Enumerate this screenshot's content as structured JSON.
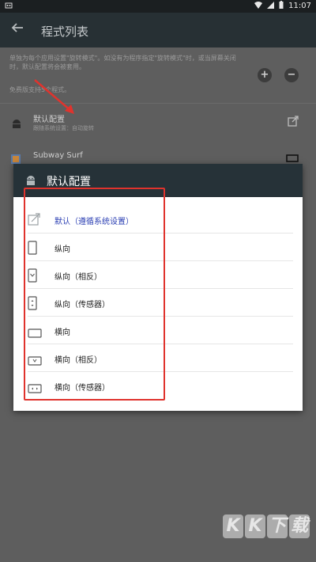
{
  "status_bar": {
    "time": "11:07",
    "left_icon": "notification-icon"
  },
  "app_bar": {
    "title": "程式列表"
  },
  "description": "单独为每个应用设置\"旋转模式\"。如没有为程序指定\"旋转模式\"时，或当屏幕关闭时，默认配置将会被套用。",
  "free_note": "免费版支持5个程式。",
  "apps": [
    {
      "name": "默认配置",
      "sub": "跟随系统设置：自动旋转"
    },
    {
      "name": "Subway Surf",
      "sub": ""
    }
  ],
  "dialog": {
    "title": "默认配置",
    "options": [
      {
        "label": "默认（遵循系统设置）",
        "icon": "follow-system-icon",
        "selected": true
      },
      {
        "label": "纵向",
        "icon": "portrait-icon",
        "selected": false
      },
      {
        "label": "纵向（相反）",
        "icon": "portrait-reverse-icon",
        "selected": false
      },
      {
        "label": "纵向（传感器）",
        "icon": "portrait-sensor-icon",
        "selected": false
      },
      {
        "label": "横向",
        "icon": "landscape-icon",
        "selected": false
      },
      {
        "label": "横向（相反）",
        "icon": "landscape-reverse-icon",
        "selected": false
      },
      {
        "label": "横向（传感器）",
        "icon": "landscape-sensor-icon",
        "selected": false
      }
    ]
  },
  "watermark": {
    "chars": [
      "K",
      "K",
      "下",
      "载"
    ]
  },
  "colors": {
    "accent": "#2b3fb3",
    "annotation": "#e0332d",
    "header": "#263238"
  }
}
